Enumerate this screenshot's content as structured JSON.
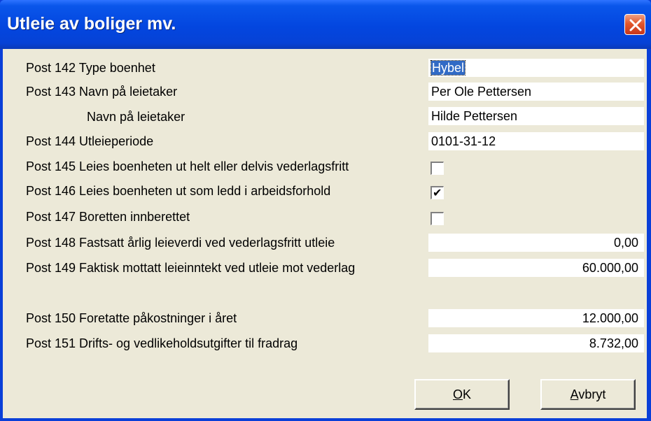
{
  "window": {
    "title": "Utleie av boliger mv.",
    "close_icon": "close-icon"
  },
  "fields": [
    {
      "label": "Post 142 Type boenhet",
      "type": "text",
      "value": "Hybel",
      "selected": true
    },
    {
      "label": "Post 143 Navn på leietaker",
      "type": "text",
      "value": "Per Ole Pettersen"
    },
    {
      "label": "Navn på leietaker",
      "type": "text",
      "value": "Hilde Pettersen"
    },
    {
      "label": "Post 144 Utleieperiode",
      "type": "text",
      "value": "0101-31-12"
    },
    {
      "label": "Post 145 Leies boenheten ut helt eller delvis vederlagsfritt",
      "type": "checkbox",
      "checked": false
    },
    {
      "label": "Post 146 Leies boenheten ut som ledd i arbeidsforhold",
      "type": "checkbox",
      "checked": true
    },
    {
      "label": "Post 147 Boretten innberettet",
      "type": "checkbox",
      "checked": false
    },
    {
      "label": "Post 148 Fastsatt årlig leieverdi ved vederlagsfritt utleie",
      "type": "number",
      "value": "0,00"
    },
    {
      "label": "Post 149 Faktisk mottatt leieinntekt ved utleie mot vederlag",
      "type": "number",
      "value": "60.000,00"
    },
    {
      "label": "Post 150 Foretatte påkostninger i året",
      "type": "number",
      "value": "12.000,00"
    },
    {
      "label": "Post 151 Drifts- og vedlikeholdsutgifter til fradrag",
      "type": "number",
      "value": "8.732,00"
    }
  ],
  "checkmark_glyph": "✔",
  "buttons": {
    "ok": {
      "mnemonic": "O",
      "rest": "K"
    },
    "cancel": {
      "mnemonic": "A",
      "rest": "vbryt"
    }
  }
}
